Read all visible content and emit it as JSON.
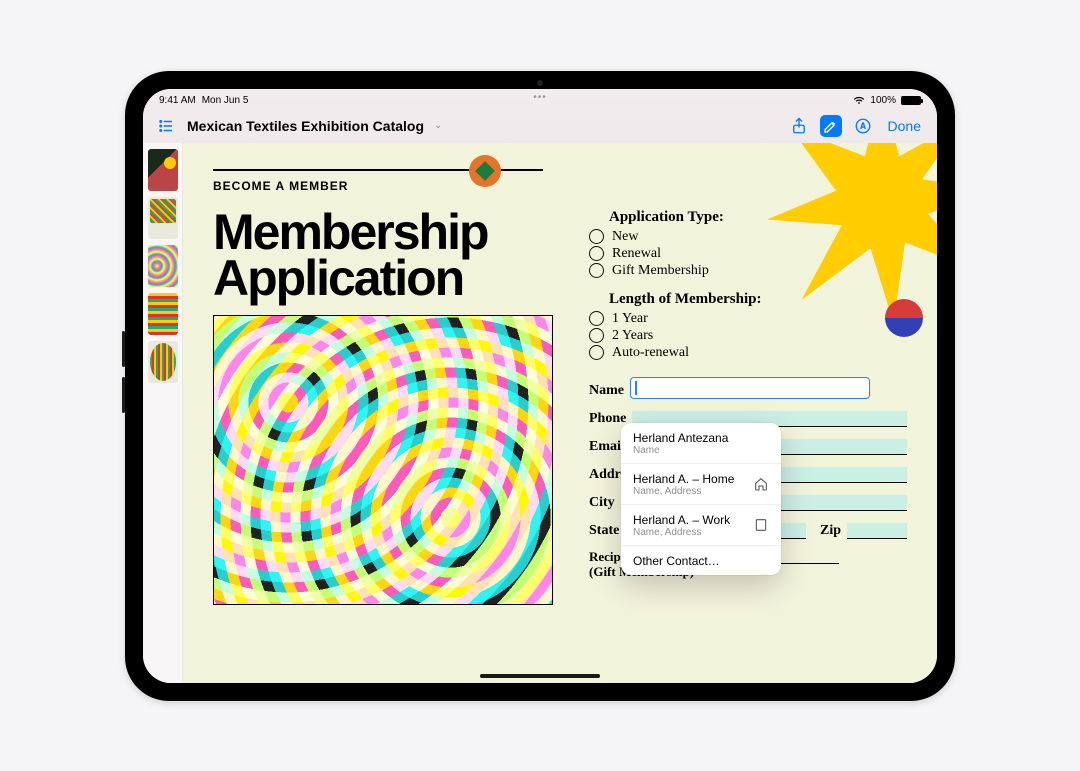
{
  "status": {
    "time": "9:41 AM",
    "date": "Mon Jun 5",
    "battery_pct": "100%"
  },
  "toolbar": {
    "title": "Mexican Textiles Exhibition Catalog",
    "done": "Done"
  },
  "doc": {
    "eyebrow": "BECOME A MEMBER",
    "headline1": "Membership",
    "headline2": "Application",
    "app_type_heading": "Application Type:",
    "app_type_options": [
      "New",
      "Renewal",
      "Gift Membership"
    ],
    "length_heading": "Length of Membership:",
    "length_options": [
      "1 Year",
      "2 Years",
      "Auto-renewal"
    ],
    "labels": {
      "name": "Name",
      "phone": "Phone",
      "email": "Email",
      "address": "Address",
      "city": "City",
      "state": "State",
      "zip": "Zip",
      "recipient": "Recipient's Name",
      "recipient_sub": "(Gift Membership)"
    }
  },
  "autocomplete": {
    "items": [
      {
        "title": "Herland Antezana",
        "sub": "Name",
        "icon": ""
      },
      {
        "title": "Herland A. – Home",
        "sub": "Name, Address",
        "icon": "home"
      },
      {
        "title": "Herland A. – Work",
        "sub": "Name, Address",
        "icon": "building"
      }
    ],
    "other": "Other Contact…"
  }
}
